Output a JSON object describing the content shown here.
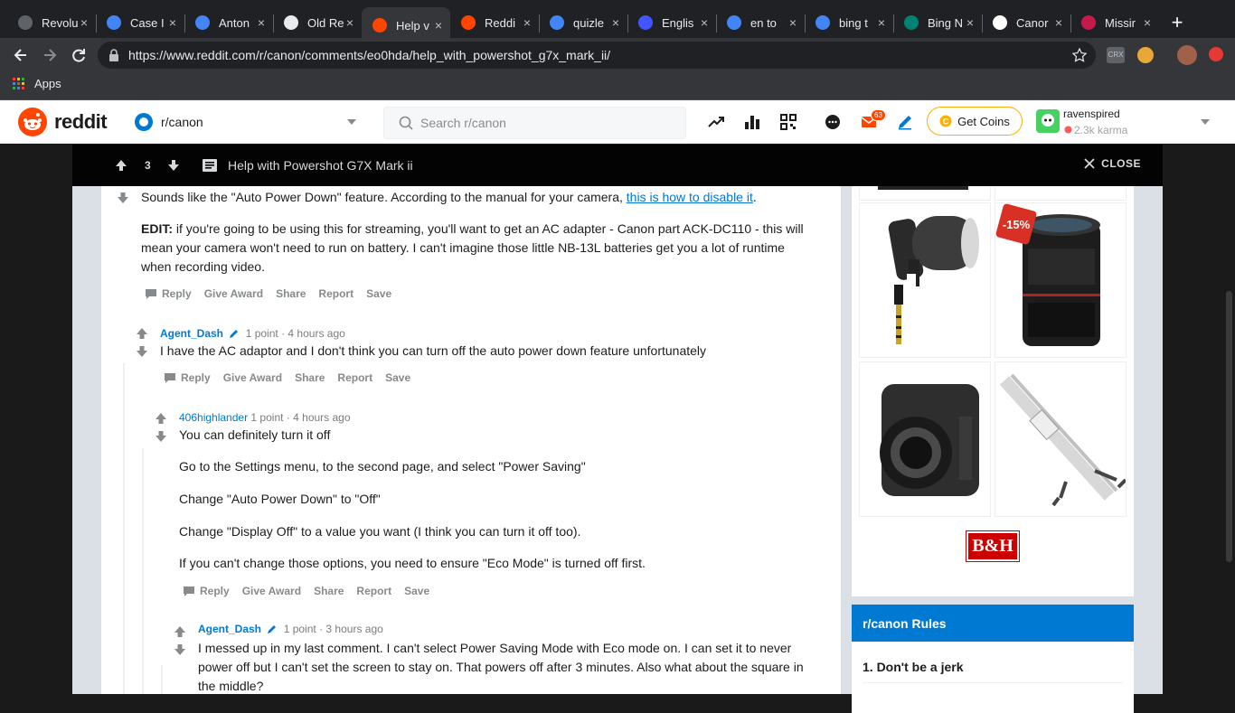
{
  "browser": {
    "tabs": [
      {
        "title": "Revolut",
        "icon": "revolut-icon",
        "color": "#5f6368"
      },
      {
        "title": "Case I",
        "icon": "docs-icon",
        "color": "#4285f4"
      },
      {
        "title": "Anton",
        "icon": "docs-icon",
        "color": "#4285f4"
      },
      {
        "title": "Old Re",
        "icon": "calendar-icon",
        "color": "#e8eaed"
      },
      {
        "title": "Help v",
        "icon": "reddit-icon",
        "color": "#ff4500"
      },
      {
        "title": "Reddi",
        "icon": "reddit-icon",
        "color": "#ff4500"
      },
      {
        "title": "quizle",
        "icon": "google-icon",
        "color": "#4285f4"
      },
      {
        "title": "Englis",
        "icon": "quizlet-icon",
        "color": "#4255ff"
      },
      {
        "title": "en to",
        "icon": "google-icon",
        "color": "#4285f4"
      },
      {
        "title": "bing t",
        "icon": "google-icon",
        "color": "#4285f4"
      },
      {
        "title": "Bing N",
        "icon": "bing-icon",
        "color": "#008373"
      },
      {
        "title": "Canor",
        "icon": "bh-icon",
        "color": "#ffffff"
      },
      {
        "title": "Missir",
        "icon": "raspberry-icon",
        "color": "#c51a4a"
      }
    ],
    "active_tab": 4,
    "url": "https://www.reddit.com/r/canon/comments/eo0hda/help_with_powershot_g7x_mark_ii/",
    "bookmarks_label": "Apps",
    "extension_crx": "CRX"
  },
  "reddit_header": {
    "wordmark": "reddit",
    "community": "r/canon",
    "search_placeholder": "Search r/canon",
    "notification_count": "63",
    "get_coins": "Get Coins",
    "username": "ravenspired",
    "karma": "2.3k karma"
  },
  "post_bar": {
    "vote_count": "3",
    "title": "Help with Powershot G7X Mark ii",
    "close_label": "CLOSE"
  },
  "comments": [
    {
      "id": "top",
      "paragraphs": [
        {
          "before": "Sounds like the \"Auto Power Down\" feature. According to the manual for your camera, ",
          "link": "this is how to disable it",
          "after": "."
        },
        {
          "bold": "EDIT:",
          "text": " if you're going to be using this for streaming, you'll want to get an AC adapter - Canon part ACK-DC110 - this will mean your camera won't need to run on battery. I can't imagine those little NB-13L batteries get you a lot of runtime when recording video."
        }
      ]
    },
    {
      "id": "agent1",
      "author": "Agent_Dash",
      "points": "1 point",
      "time": "4 hours ago",
      "text": "I have the AC adaptor and I don't think you can turn off the auto power down feature unfortunately"
    },
    {
      "id": "highlander",
      "author": "406highlander",
      "points": "1 point",
      "time": "4 hours ago",
      "lines": [
        "You can definitely turn it off",
        "Go to the Settings menu, to the second page, and select \"Power Saving\"",
        "Change \"Auto Power Down\" to \"Off\"",
        "Change \"Display Off\" to a value you want (I think you can turn it off too).",
        "If you can't change those options, you need to ensure \"Eco Mode\" is turned off first."
      ]
    },
    {
      "id": "agent2",
      "author": "Agent_Dash",
      "points": "1 point",
      "time": "3 hours ago",
      "text": "I messed up in my last comment. I can't select Power Saving Mode with Eco mode on. I can set it to never power off but I can't set the screen to stay on. That powers off after 3 minutes. Also what about the square in the middle?"
    }
  ],
  "actions": {
    "reply": "Reply",
    "give_award": "Give Award",
    "share": "Share",
    "report": "Report",
    "save": "Save"
  },
  "meta_separator": "·",
  "sidebar": {
    "discount_badge": "-15%",
    "ad_logo": "B&H",
    "rules_title": "r/canon Rules",
    "rules": [
      "1. Don't be a jerk"
    ]
  }
}
